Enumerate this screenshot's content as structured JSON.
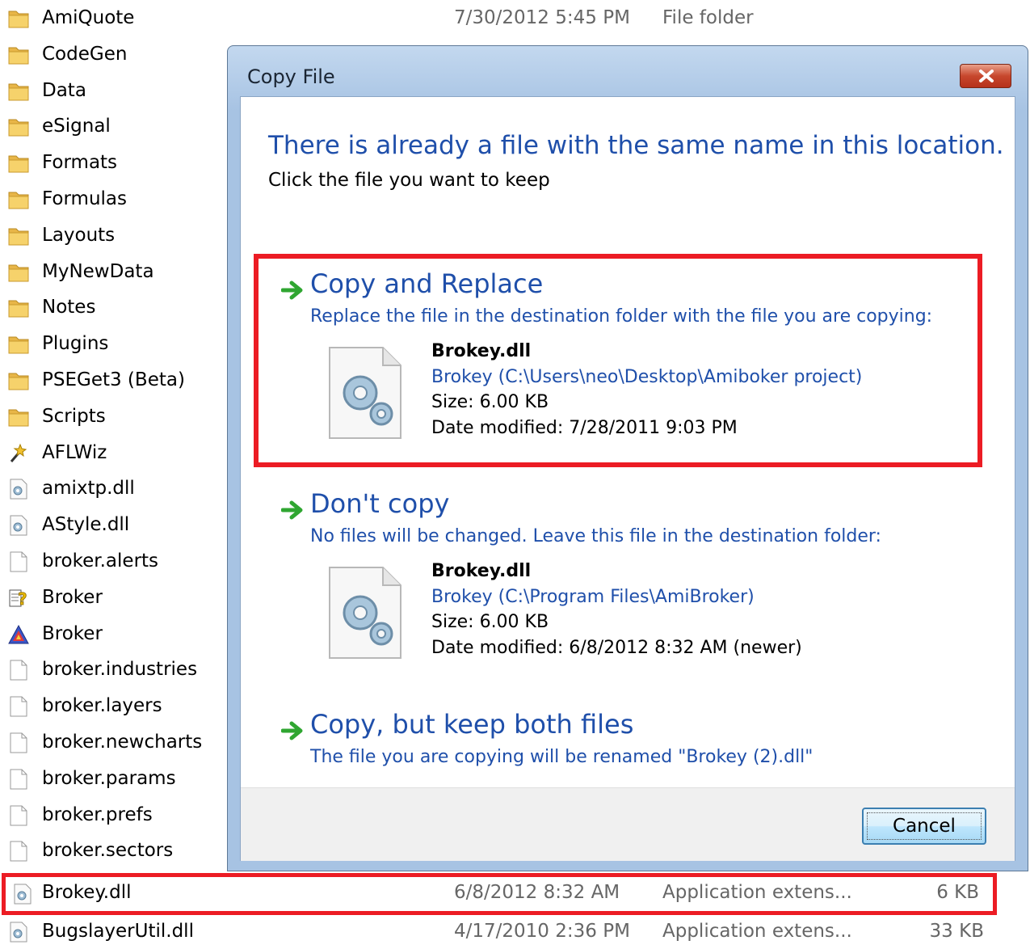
{
  "explorer": {
    "rows": [
      {
        "name": "AmiQuote",
        "date": "7/30/2012 5:45 PM",
        "type": "File folder",
        "size": "",
        "icon": "folder-icon"
      },
      {
        "name": "CodeGen",
        "date": "",
        "type": "",
        "size": "",
        "icon": "folder-icon"
      },
      {
        "name": "Data",
        "date": "",
        "type": "",
        "size": "",
        "icon": "folder-icon"
      },
      {
        "name": "eSignal",
        "date": "",
        "type": "",
        "size": "",
        "icon": "folder-icon"
      },
      {
        "name": "Formats",
        "date": "",
        "type": "",
        "size": "",
        "icon": "folder-icon"
      },
      {
        "name": "Formulas",
        "date": "",
        "type": "",
        "size": "",
        "icon": "folder-icon"
      },
      {
        "name": "Layouts",
        "date": "",
        "type": "",
        "size": "",
        "icon": "folder-icon"
      },
      {
        "name": "MyNewData",
        "date": "",
        "type": "",
        "size": "",
        "icon": "folder-icon"
      },
      {
        "name": "Notes",
        "date": "",
        "type": "",
        "size": "",
        "icon": "folder-icon"
      },
      {
        "name": "Plugins",
        "date": "",
        "type": "",
        "size": "",
        "icon": "folder-icon"
      },
      {
        "name": "PSEGet3 (Beta)",
        "date": "",
        "type": "",
        "size": "",
        "icon": "folder-icon"
      },
      {
        "name": "Scripts",
        "date": "",
        "type": "",
        "size": "",
        "icon": "folder-icon"
      },
      {
        "name": "AFLWiz",
        "date": "",
        "type": "",
        "size": "",
        "icon": "wand-icon"
      },
      {
        "name": "amixtp.dll",
        "date": "",
        "type": "",
        "size": "",
        "icon": "dll-icon"
      },
      {
        "name": "AStyle.dll",
        "date": "",
        "type": "",
        "size": "",
        "icon": "dll-icon"
      },
      {
        "name": "broker.alerts",
        "date": "",
        "type": "",
        "size": "",
        "icon": "blank-file-icon"
      },
      {
        "name": "Broker",
        "date": "",
        "type": "",
        "size": "",
        "icon": "help-file-icon"
      },
      {
        "name": "Broker",
        "date": "",
        "type": "",
        "size": "",
        "icon": "amibroker-icon"
      },
      {
        "name": "broker.industries",
        "date": "",
        "type": "",
        "size": "",
        "icon": "blank-file-icon"
      },
      {
        "name": "broker.layers",
        "date": "",
        "type": "",
        "size": "",
        "icon": "blank-file-icon"
      },
      {
        "name": "broker.newcharts",
        "date": "",
        "type": "",
        "size": "",
        "icon": "blank-file-icon"
      },
      {
        "name": "broker.params",
        "date": "",
        "type": "",
        "size": "",
        "icon": "blank-file-icon"
      },
      {
        "name": "broker.prefs",
        "date": "",
        "type": "",
        "size": "",
        "icon": "blank-file-icon"
      },
      {
        "name": "broker.sectors",
        "date": "",
        "type": "",
        "size": "",
        "icon": "blank-file-icon"
      }
    ],
    "highlighted": {
      "name": "Brokey.dll",
      "date": "6/8/2012 8:32 AM",
      "type": "Application extens...",
      "size": "6 KB",
      "icon": "dll-icon"
    },
    "last": {
      "name": "BugslayerUtil.dll",
      "date": "4/17/2010 2:36 PM",
      "type": "Application extens...",
      "size": "33 KB",
      "icon": "dll-icon"
    }
  },
  "dialog": {
    "title": "Copy File",
    "headline": "There is already a file with the same name in this location.",
    "subline": "Click the file you want to keep",
    "replace": {
      "title": "Copy and Replace",
      "desc": "Replace the file in the destination folder with the file you are copying:",
      "file_name": "Brokey.dll",
      "file_path": "Brokey (C:\\Users\\neo\\Desktop\\Amiboker project)",
      "file_size": "Size: 6.00 KB",
      "file_date": "Date modified: 7/28/2011 9:03 PM"
    },
    "dontcopy": {
      "title": "Don't copy",
      "desc": "No files will be changed. Leave this file in the destination folder:",
      "file_name": "Brokey.dll",
      "file_path": "Brokey (C:\\Program Files\\AmiBroker)",
      "file_size": "Size: 6.00 KB",
      "file_date": "Date modified: 6/8/2012 8:32 AM (newer)"
    },
    "keepboth": {
      "title": "Copy, but keep both files",
      "desc": "The file you are copying will be renamed \"Brokey (2).dll\""
    },
    "cancel_label": "Cancel"
  },
  "colors": {
    "accent_blue": "#1f4faa",
    "highlight_red": "#ec1c24",
    "arrow_green": "#2fa631"
  }
}
